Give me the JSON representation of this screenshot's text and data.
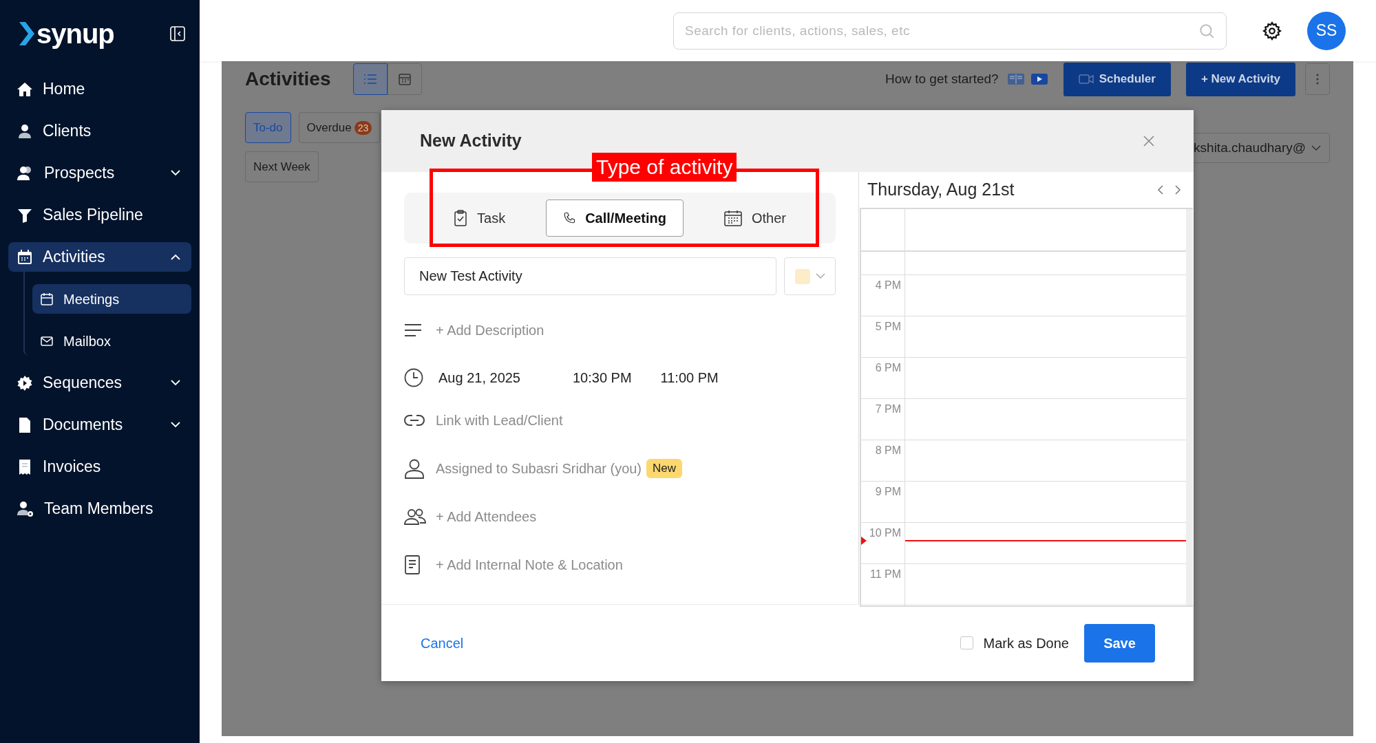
{
  "sidebar": {
    "logo": "synup",
    "items": [
      {
        "label": "Home"
      },
      {
        "label": "Clients"
      },
      {
        "label": "Prospects",
        "expanded": false
      },
      {
        "label": "Sales Pipeline"
      },
      {
        "label": "Activities",
        "expanded": true,
        "selected": true,
        "children": [
          {
            "label": "Meetings",
            "selected": true
          },
          {
            "label": "Mailbox",
            "selected": false
          }
        ]
      },
      {
        "label": "Sequences",
        "expanded": false
      },
      {
        "label": "Documents",
        "expanded": false
      },
      {
        "label": "Invoices"
      },
      {
        "label": "Team Members"
      }
    ]
  },
  "header": {
    "search": {
      "placeholder": "Search for clients, actions, sales, etc"
    },
    "avatar": "SS"
  },
  "page": {
    "title": "Activities",
    "views": [
      {
        "selected": true
      },
      {
        "selected": false
      }
    ],
    "help": "How to get started?",
    "buttons": [
      "Scheduler",
      "+ New Activity"
    ],
    "filters": [
      {
        "label": "To-do",
        "selected": true
      },
      {
        "label": "Overdue",
        "count": "23",
        "selected": false
      },
      {
        "label": "Next Week",
        "selected": false
      }
    ],
    "user_select": "kshita.chaudhary@"
  },
  "modal": {
    "title": "New Activity",
    "annotation": "Type of activity",
    "types": [
      {
        "label": "Task",
        "selected": false
      },
      {
        "label": "Call/Meeting",
        "selected": true
      },
      {
        "label": "Other",
        "selected": false
      }
    ],
    "title_field": {
      "value": "New Test Activity"
    },
    "color_picker": {
      "color": "#fdecc8"
    },
    "rows": [
      {
        "kind": "link",
        "label": "+ Add Description"
      },
      {
        "kind": "datetime",
        "date": "Aug 21, 2025",
        "start": "10:30 PM",
        "end": "11:00 PM"
      },
      {
        "kind": "link",
        "label": "Link with Lead/Client"
      },
      {
        "kind": "assignee",
        "label": "Assigned to Subasri Sridhar (you)",
        "badge": "New"
      },
      {
        "kind": "link",
        "label": "+ Add Attendees"
      },
      {
        "kind": "link",
        "label": "+ Add Internal Note & Location"
      }
    ],
    "cancel": "Cancel",
    "mark_done": {
      "label": "Mark as Done",
      "checked": false
    },
    "save": "Save",
    "calendar": {
      "title": "Thursday, Aug 21st",
      "hours": [
        "4 PM",
        "5 PM",
        "6 PM",
        "7 PM",
        "8 PM",
        "9 PM",
        "10 PM",
        "11 PM"
      ]
    }
  }
}
